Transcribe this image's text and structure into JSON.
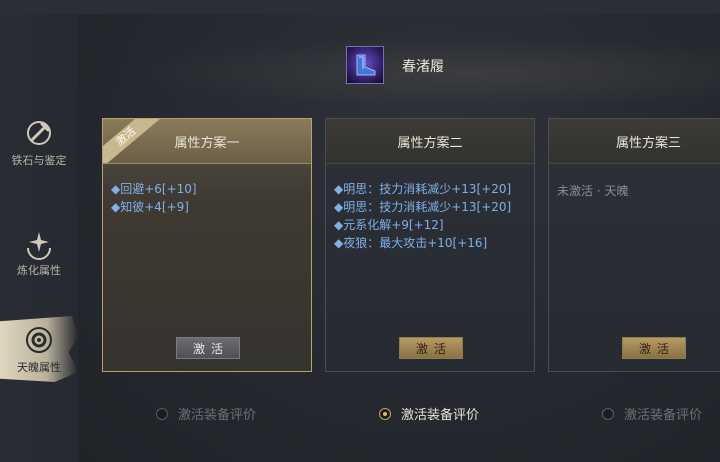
{
  "sidebar": {
    "items": [
      {
        "label": "铁石与鉴定",
        "icon": "sword-icon",
        "active": false
      },
      {
        "label": "炼化属性",
        "icon": "sparkle-icon",
        "active": false
      },
      {
        "label": "天魄属性",
        "icon": "eye-icon",
        "active": true
      }
    ]
  },
  "item": {
    "name": "春渚履",
    "icon": "boots-icon"
  },
  "cards": [
    {
      "title": "属性方案一",
      "ribbon": "激活",
      "attributes": [
        "◆回避+6[+10]",
        "◆知彼+4[+9]"
      ],
      "inactive_text": "",
      "button": "激活",
      "button_style": "gray",
      "radio_label": "激活装备评价",
      "radio_selected": false
    },
    {
      "title": "属性方案二",
      "ribbon": "",
      "attributes": [
        "◆明思：技力消耗减少+13[+20]",
        "◆明思：技力消耗减少+13[+20]",
        "◆元系化解+9[+12]",
        "◆夜狼：最大攻击+10[+16]"
      ],
      "inactive_text": "",
      "button": "激活",
      "button_style": "gold",
      "radio_label": "激活装备评价",
      "radio_selected": true
    },
    {
      "title": "属性方案三",
      "ribbon": "",
      "attributes": [],
      "inactive_text": "未激活 · 天魄",
      "button": "激活",
      "button_style": "gold",
      "radio_label": "激活装备评价",
      "radio_selected": false
    }
  ],
  "colors": {
    "attr_text": "#7fb0e6",
    "gold": "#b59a62",
    "radio_on": "#e8b84e"
  }
}
